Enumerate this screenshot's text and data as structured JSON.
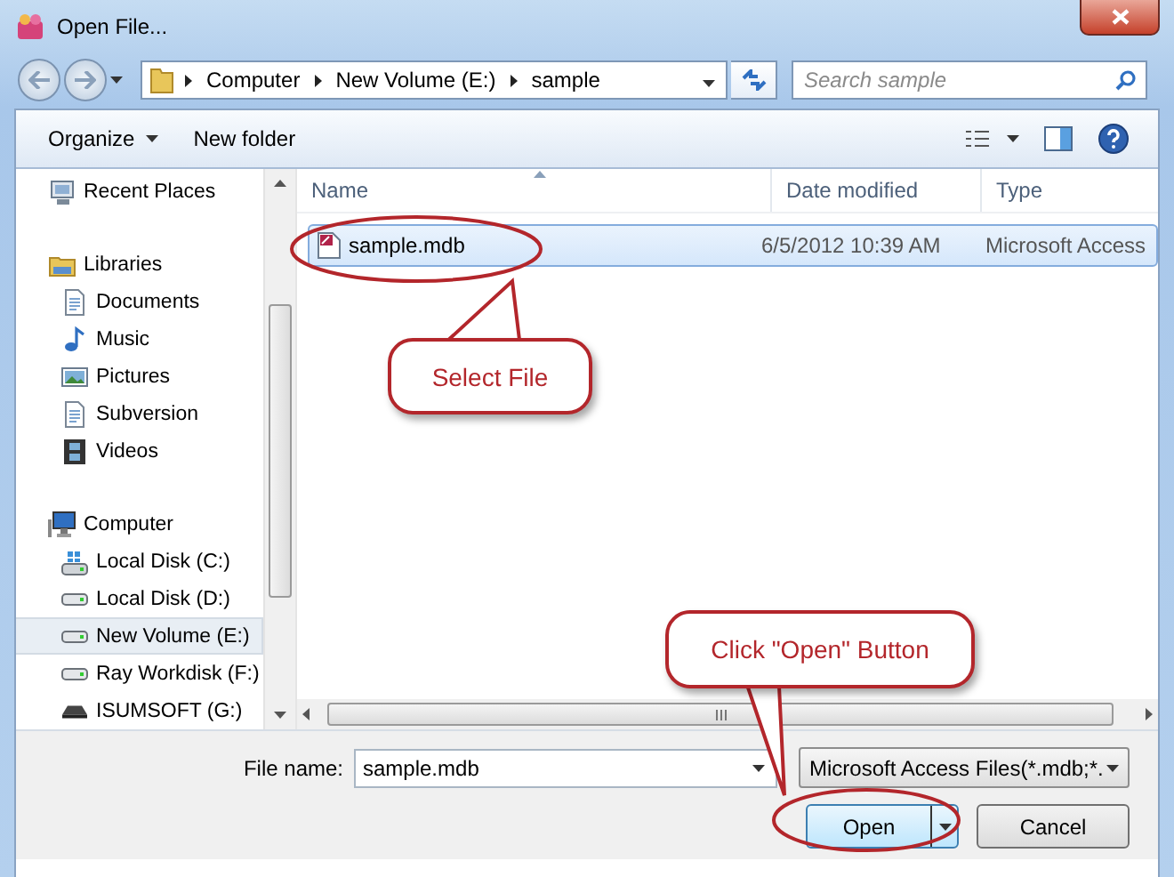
{
  "window": {
    "title": "Open File..."
  },
  "address": {
    "segments": [
      "Computer",
      "New Volume (E:)",
      "sample"
    ]
  },
  "search": {
    "placeholder": "Search sample"
  },
  "toolbar": {
    "items": [
      {
        "label": "Organize",
        "dropdown": true
      },
      {
        "label": "New folder",
        "dropdown": false
      }
    ]
  },
  "sidebar": {
    "items": [
      {
        "label": "Recent Places",
        "kind": "recent",
        "selected": false
      },
      {
        "label": "Libraries",
        "kind": "library",
        "selected": false,
        "children": [
          {
            "label": "Documents",
            "kind": "document",
            "selected": false
          },
          {
            "label": "Music",
            "kind": "music",
            "selected": false
          },
          {
            "label": "Pictures",
            "kind": "pictures",
            "selected": false
          },
          {
            "label": "Subversion",
            "kind": "document",
            "selected": false
          },
          {
            "label": "Videos",
            "kind": "videos",
            "selected": false
          }
        ]
      },
      {
        "label": "Computer",
        "kind": "computer",
        "selected": false,
        "children": [
          {
            "label": "Local Disk (C:)",
            "kind": "system-disk",
            "selected": false
          },
          {
            "label": "Local Disk (D:)",
            "kind": "disk",
            "selected": false
          },
          {
            "label": "New Volume (E:)",
            "kind": "disk",
            "selected": true
          },
          {
            "label": "Ray Workdisk (F:)",
            "kind": "disk",
            "selected": false
          },
          {
            "label": "ISUMSOFT (G:)",
            "kind": "removable",
            "selected": false
          }
        ]
      }
    ]
  },
  "table": {
    "columns": [
      {
        "label": "Name",
        "sorted": true
      },
      {
        "label": "Date modified",
        "sorted": false
      },
      {
        "label": "Type",
        "sorted": false
      }
    ],
    "rows": [
      {
        "cells": [
          "sample.mdb",
          "6/5/2012 10:39 AM",
          "Microsoft Access"
        ],
        "selected": true
      }
    ]
  },
  "file_name": {
    "label": "File name:",
    "value": "sample.mdb"
  },
  "file_type": {
    "value": "Microsoft Access Files(*.mdb;*."
  },
  "buttons": [
    {
      "label": "Open",
      "kind": "split"
    },
    {
      "label": "Cancel",
      "kind": "plain"
    }
  ],
  "annotations": [
    {
      "text": "Select File",
      "kind": "file"
    },
    {
      "text": "Click \"Open\" Button",
      "kind": "open"
    }
  ]
}
